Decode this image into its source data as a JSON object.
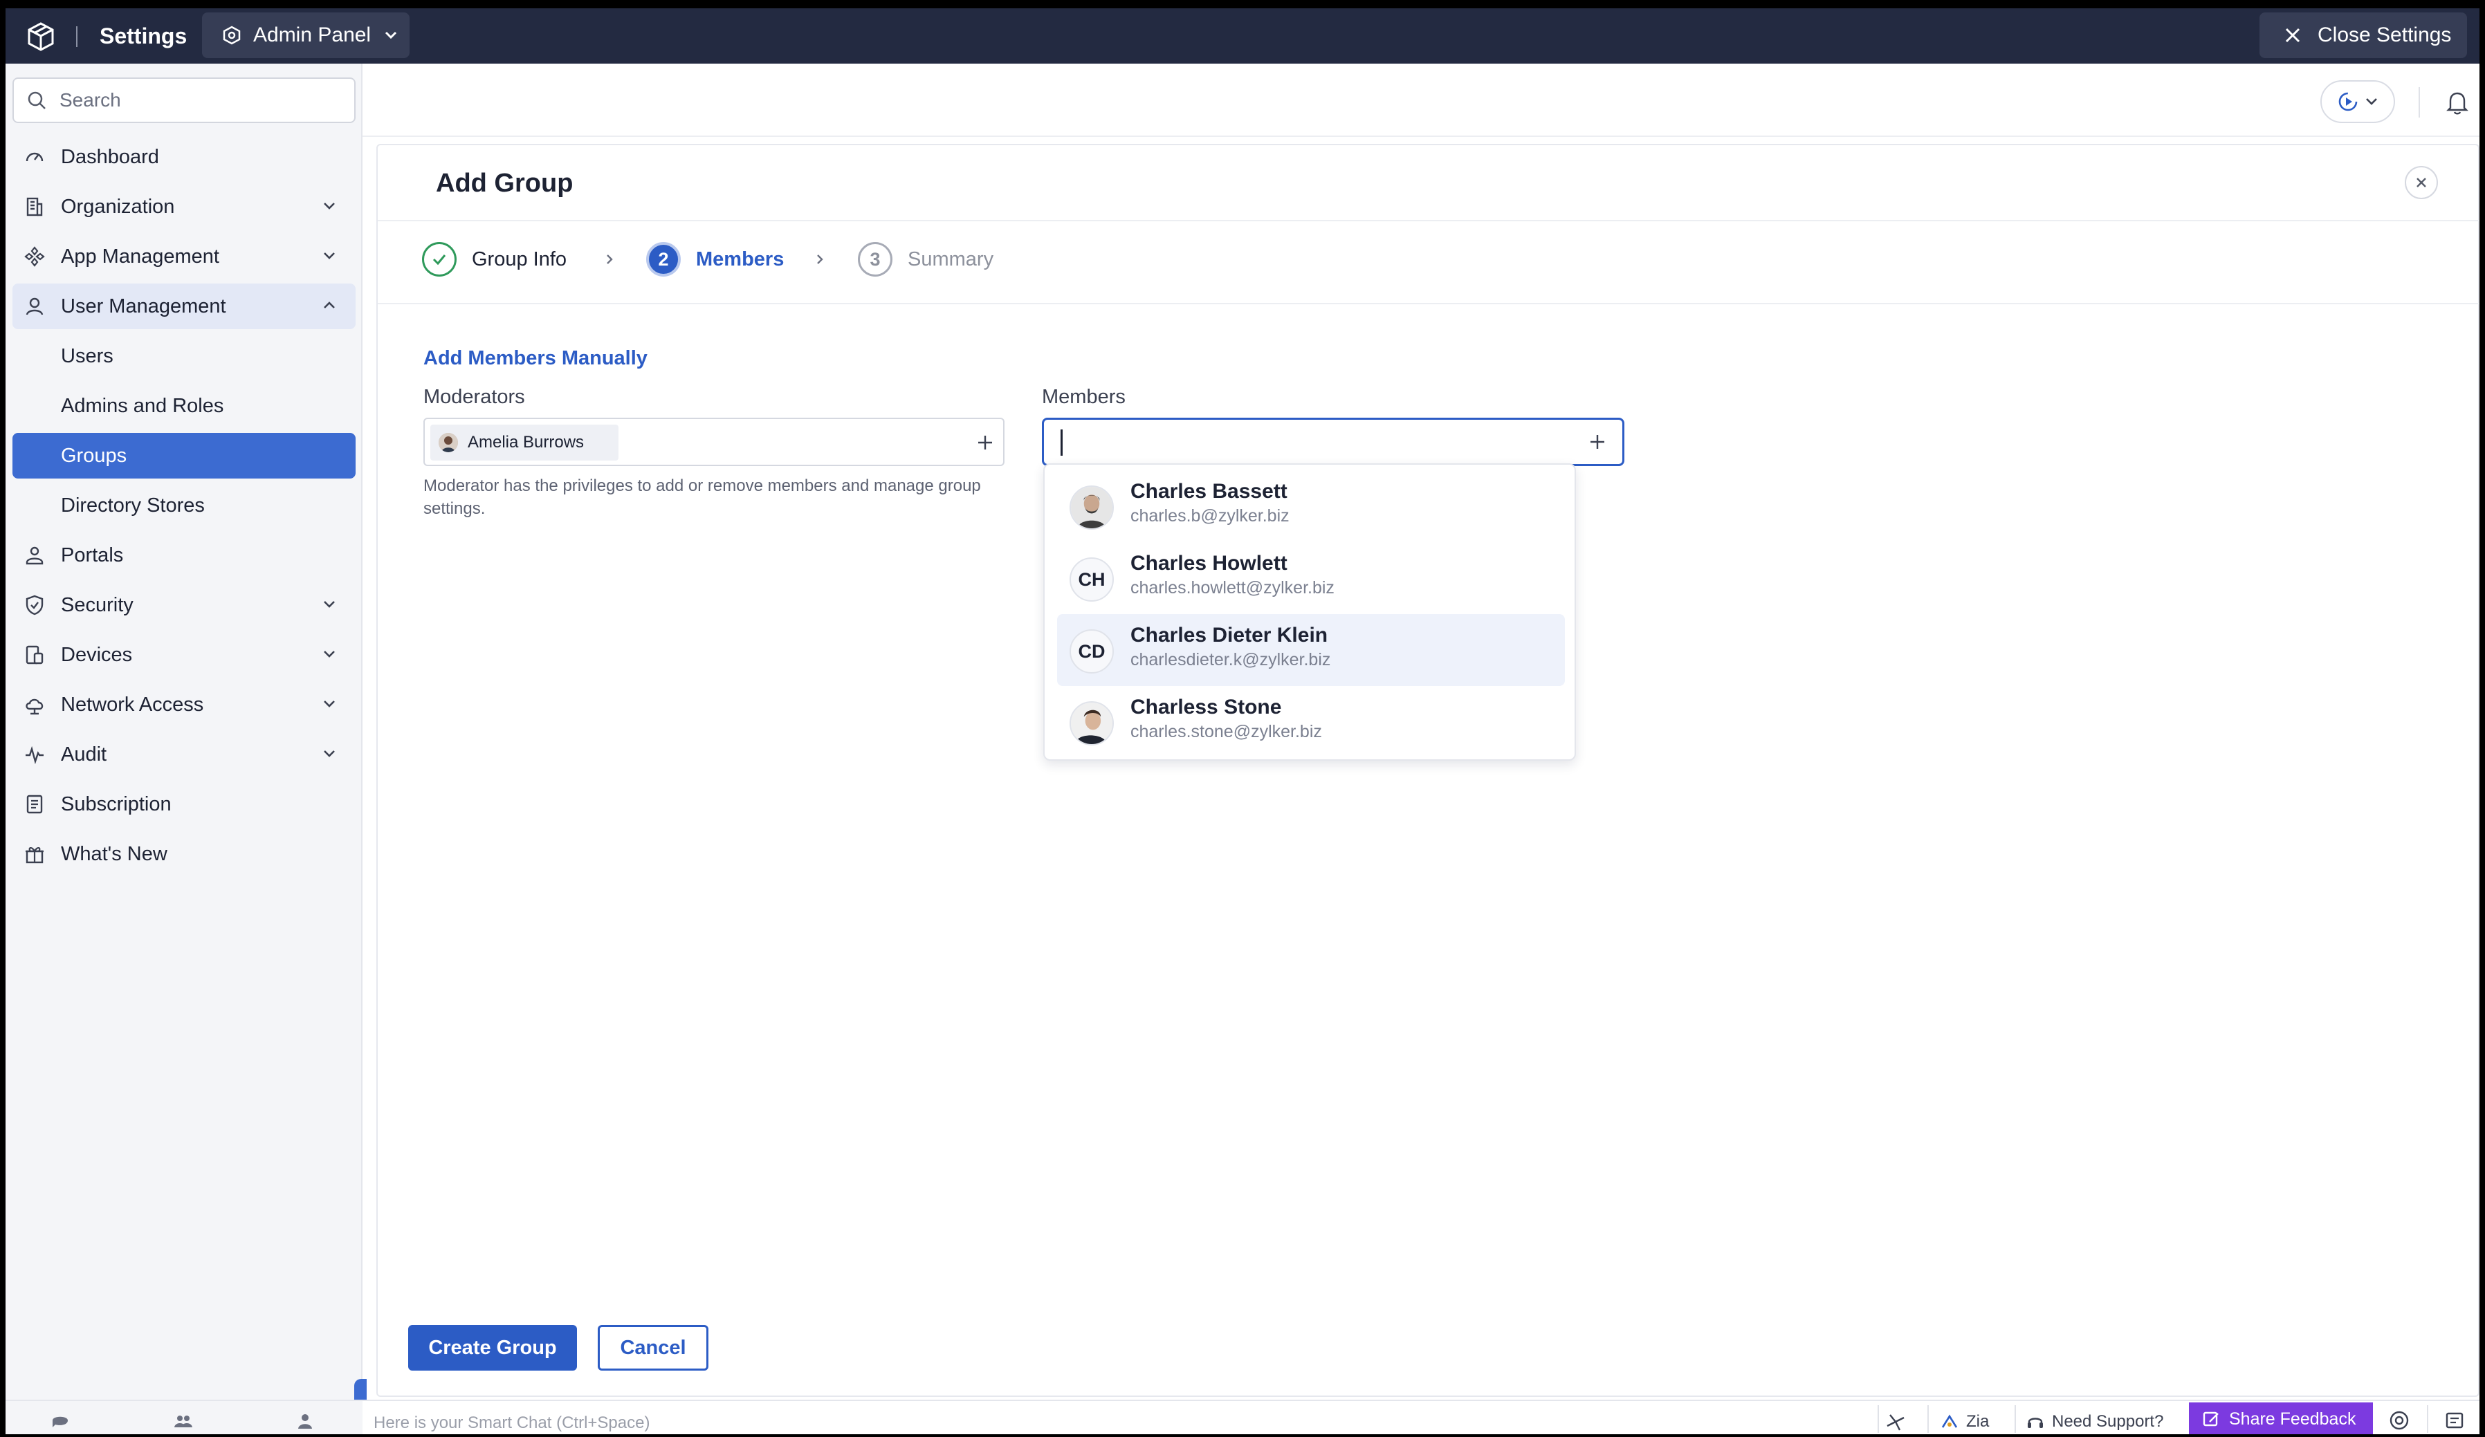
{
  "topbar": {
    "title": "Settings",
    "panel_switcher": "Admin Panel",
    "close_label": "Close Settings"
  },
  "sidebar": {
    "search_placeholder": "Search",
    "items": [
      {
        "label": "Dashboard",
        "icon": "dashboard-icon"
      },
      {
        "label": "Organization",
        "icon": "building-icon"
      },
      {
        "label": "App Management",
        "icon": "apps-icon"
      },
      {
        "label": "User Management",
        "icon": "user-icon",
        "expanded": true
      },
      {
        "label": "Users"
      },
      {
        "label": "Admins and Roles"
      },
      {
        "label": "Groups",
        "active": true
      },
      {
        "label": "Directory Stores"
      },
      {
        "label": "Portals",
        "icon": "portal-icon"
      },
      {
        "label": "Security",
        "icon": "shield-icon"
      },
      {
        "label": "Devices",
        "icon": "devices-icon"
      },
      {
        "label": "Network Access",
        "icon": "cloud-icon"
      },
      {
        "label": "Audit",
        "icon": "activity-icon"
      },
      {
        "label": "Subscription",
        "icon": "document-icon"
      },
      {
        "label": "What's New",
        "icon": "gift-icon"
      }
    ]
  },
  "dialog": {
    "title": "Add Group",
    "steps": [
      {
        "label": "Group Info",
        "state": "done"
      },
      {
        "label": "Members",
        "number": "2",
        "state": "current"
      },
      {
        "label": "Summary",
        "number": "3",
        "state": "todo"
      }
    ],
    "section_title": "Add Members Manually",
    "moderators_label": "Moderators",
    "moderator_chip": "Amelia Burrows",
    "moderator_hint": "Moderator has the privileges to add or remove members and manage group settings.",
    "members_label": "Members",
    "suggestions": [
      {
        "name": "Charles Bassett",
        "email": "charles.b@zylker.biz",
        "initials": ""
      },
      {
        "name": "Charles Howlett",
        "email": "charles.howlett@zylker.biz",
        "initials": "CH"
      },
      {
        "name": "Charles Dieter Klein",
        "email": "charlesdieter.k@zylker.biz",
        "initials": "CD",
        "highlighted": true
      },
      {
        "name": "Charless Stone",
        "email": "charles.stone@zylker.biz",
        "initials": ""
      }
    ],
    "create_button": "Create Group",
    "cancel_button": "Cancel"
  },
  "bottombar": {
    "smart_chat_placeholder": "Here is your Smart Chat (Ctrl+Space)",
    "zia": "Zia",
    "need_support": "Need Support?",
    "share_feedback": "Share Feedback"
  },
  "colors": {
    "topbar": "#232a41",
    "accent": "#2c5cc5",
    "active_nav": "#3c6bd1",
    "feedback": "#7c3ae0",
    "done_step": "#2f9a5b"
  }
}
